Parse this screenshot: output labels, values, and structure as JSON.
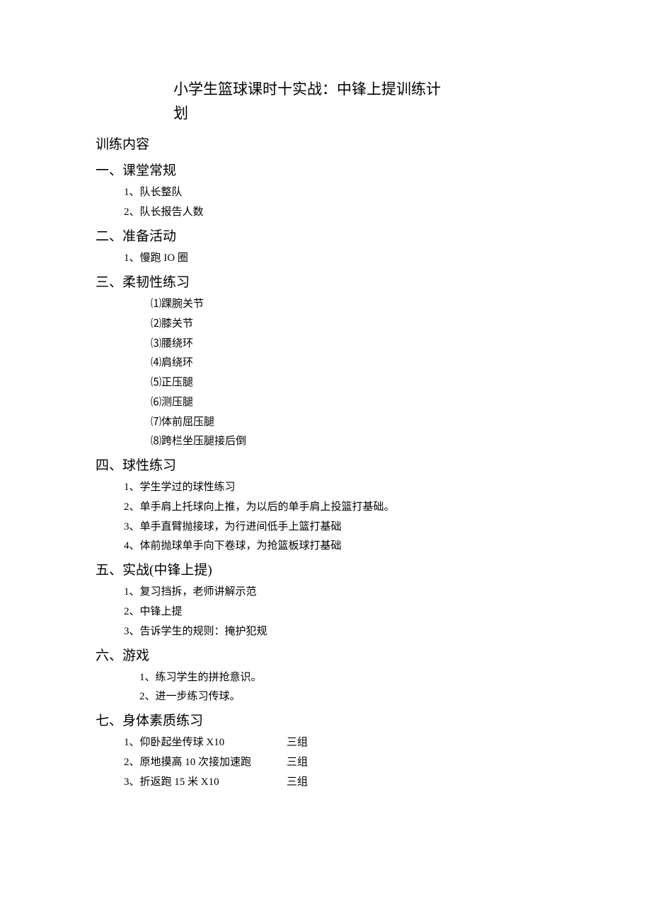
{
  "title": "小学生篮球课时十实战：中锋上提训练计划",
  "content_label": "训练内容",
  "section1": {
    "heading": "一、课堂常规",
    "items": [
      "1、队长整队",
      "2、队长报告人数"
    ]
  },
  "section2": {
    "heading": "二、准备活动",
    "items": [
      "1、慢跑 IO 圈"
    ]
  },
  "section3": {
    "heading": "三、柔韧性练习",
    "items": [
      "⑴踝腕关节",
      "⑵膝关节",
      "⑶腰绕环",
      "⑷肩绕环",
      "⑸正压腿",
      "⑹测压腿",
      "⑺体前屈压腿",
      "⑻跨栏坐压腿接后倒"
    ]
  },
  "section4": {
    "heading": "四、球性练习",
    "items": [
      "1、学生学过的球性练习",
      "2、单手肩上托球向上推，为以后的单手肩上投篮打基础。",
      "3、单手直臂抛接球，为行进间低手上篮打基础",
      "4、体前抛球单手向下卷球，为抢篮板球打基础"
    ]
  },
  "section5": {
    "heading": "五、实战(中锋上提)",
    "items": [
      "1、复习挡拆，老师讲解示范",
      "2、中锋上提",
      "3、告诉学生的规则：掩护犯规"
    ]
  },
  "section6": {
    "heading": "六、游戏",
    "items": [
      "1、练习学生的拼抢意识。",
      "2、进一步练习传球。"
    ]
  },
  "section7": {
    "heading": "七、身体素质练习",
    "exercises": [
      {
        "label": "1、仰卧起坐传球 X10",
        "group": "三组"
      },
      {
        "label": "2、原地摸高 10 次接加速跑",
        "group": "三组"
      },
      {
        "label": "3、折返跑 15 米 X10",
        "group": "三组"
      }
    ]
  }
}
